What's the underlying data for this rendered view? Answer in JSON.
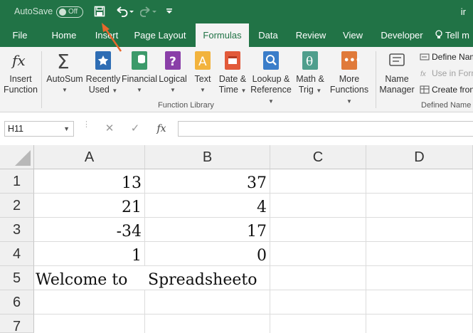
{
  "titlebar": {
    "autosave_label": "AutoSave",
    "autosave_state": "Off",
    "title_cut": "ir"
  },
  "tabs": [
    {
      "label": "File"
    },
    {
      "label": "Home"
    },
    {
      "label": "Insert"
    },
    {
      "label": "Page Layout"
    },
    {
      "label": "Formulas",
      "active": true
    },
    {
      "label": "Data"
    },
    {
      "label": "Review"
    },
    {
      "label": "View"
    },
    {
      "label": "Developer"
    },
    {
      "label": "Tell m"
    }
  ],
  "ribbon": {
    "insert_function": {
      "line1": "Insert",
      "line2": "Function"
    },
    "autosum": {
      "line1": "AutoSum"
    },
    "recently_used": {
      "line1": "Recently",
      "line2": "Used"
    },
    "financial": {
      "line1": "Financial"
    },
    "logical": {
      "line1": "Logical"
    },
    "text": {
      "line1": "Text"
    },
    "date_time": {
      "line1": "Date &",
      "line2": "Time"
    },
    "lookup_reference": {
      "line1": "Lookup &",
      "line2": "Reference"
    },
    "math_trig": {
      "line1": "Math &",
      "line2": "Trig"
    },
    "more_functions": {
      "line1": "More",
      "line2": "Functions"
    },
    "function_library_label": "Function Library",
    "name_manager": {
      "line1": "Name",
      "line2": "Manager"
    },
    "define_name": "Define Nam",
    "use_in_formula": "Use in Form",
    "create_from": "Create fron",
    "defined_names_label": "Defined Name"
  },
  "formula_bar": {
    "name_box": "H11",
    "cancel_symbol": "✕",
    "enter_symbol": "✓",
    "fx_symbol": "fx",
    "formula": ""
  },
  "grid": {
    "columns": [
      "A",
      "B",
      "C",
      "D"
    ],
    "rows": [
      "1",
      "2",
      "3",
      "4",
      "5",
      "6",
      "7"
    ],
    "cells": {
      "A1": "13",
      "B1": "37",
      "A2": "21",
      "B2": "4",
      "A3": "-34",
      "B3": "17",
      "A4": "1",
      "B4": "0",
      "A5": "Welcome to",
      "B5": "Spreadsheeto"
    }
  },
  "colors": {
    "excel_green": "#217346",
    "annotation_arrow": "#e8672c"
  }
}
